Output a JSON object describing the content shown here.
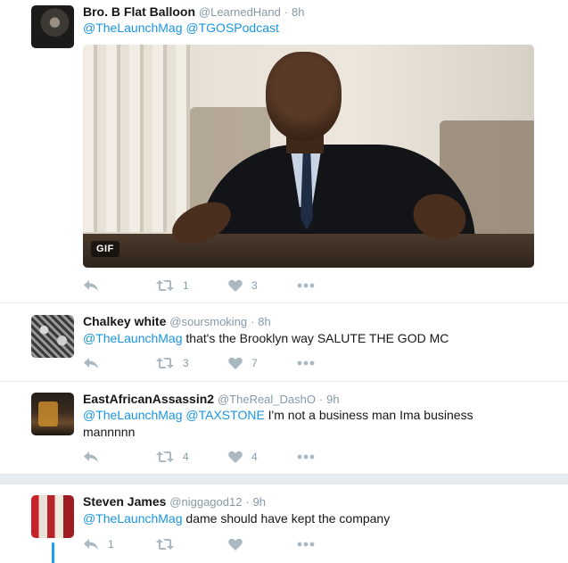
{
  "tweets": [
    {
      "name": "Bro. B Flat Balloon",
      "handle": "@LearnedHand",
      "sep": "·",
      "time": "8h",
      "mentions": [
        "@TheLaunchMag",
        "@TGOSPodcast"
      ],
      "text": "",
      "media_badge": "GIF",
      "retweets": "1",
      "likes": "3"
    },
    {
      "name": "Chalkey white",
      "handle": "@soursmoking",
      "sep": "·",
      "time": "8h",
      "mentions": [
        "@TheLaunchMag"
      ],
      "text": " that's the Brooklyn way SALUTE THE GOD MC",
      "retweets": "3",
      "likes": "7"
    },
    {
      "name": "EastAfricanAssassin2",
      "handle": "@TheReal_DashO",
      "sep": "·",
      "time": "9h",
      "mentions": [
        "@TheLaunchMag",
        "@TAXSTONE"
      ],
      "text": " I'm not a business man Ima business mannnnn",
      "retweets": "4",
      "likes": "4"
    },
    {
      "name": "Steven James",
      "handle": "@niggagod12",
      "sep": "·",
      "time": "9h",
      "mentions": [
        "@TheLaunchMag"
      ],
      "text": " dame should have kept the company",
      "replies": "1",
      "retweets": "",
      "likes": ""
    }
  ],
  "icons": {
    "reply": "reply-icon",
    "retweet": "retweet-icon",
    "like": "heart-icon",
    "more": "more-icon"
  },
  "colors": {
    "link": "#1b95e0",
    "action_gray": "#aab8c2",
    "meta_gray": "#8899a6",
    "thread_line": "#1da1f2"
  }
}
